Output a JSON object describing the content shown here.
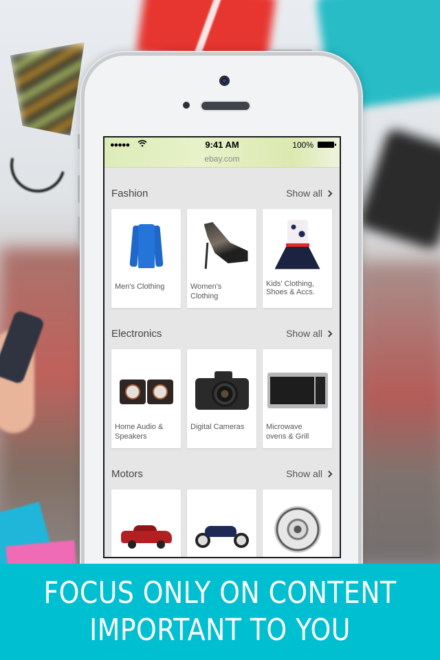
{
  "status_bar": {
    "signal": "●●●●●",
    "wifi_icon": "wifi-icon",
    "time": "9:41 AM",
    "battery_percent": "100%",
    "battery_icon": "battery-icon",
    "url": "ebay.com"
  },
  "sections": [
    {
      "title": "Fashion",
      "show_all": "Show all",
      "items": [
        {
          "label": "Men's Clothing",
          "icon": "blue-sweater-image"
        },
        {
          "label": "Women's Clothing",
          "icon": "high-heel-shoe-image"
        },
        {
          "label": "Kids' Clothing, Shoes & Accs.",
          "icon": "kids-dress-image"
        }
      ]
    },
    {
      "title": "Electronics",
      "show_all": "Show all",
      "items": [
        {
          "label": "Home Audio & Speakers",
          "icon": "speakers-image"
        },
        {
          "label": "Digital Cameras",
          "icon": "dslr-camera-image"
        },
        {
          "label": "Microwave ovens & Grill",
          "icon": "microwave-image"
        }
      ]
    },
    {
      "title": "Motors",
      "show_all": "Show all",
      "items": [
        {
          "label": "",
          "icon": "red-car-image"
        },
        {
          "label": "",
          "icon": "motorcycle-image"
        },
        {
          "label": "",
          "icon": "chrome-wheel-image"
        }
      ]
    }
  ],
  "banner": {
    "line1": "FOCUS ONLY ON CONTENT",
    "line2": "IMPORTANT TO YOU",
    "color": "#00bfd1"
  }
}
